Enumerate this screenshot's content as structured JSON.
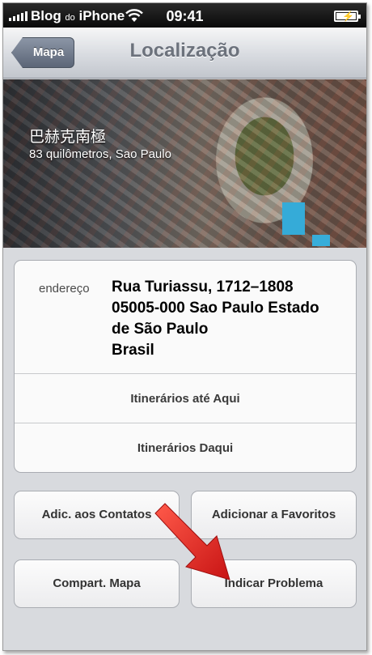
{
  "status_bar": {
    "carrier": "Blog",
    "carrier_small": "do",
    "carrier_tail": "iPhone",
    "time": "09:41"
  },
  "nav": {
    "back_label": "Mapa",
    "title": "Localização"
  },
  "place": {
    "name": "巴赫克南極",
    "subtitle": "83 quilômetros, Sao Paulo"
  },
  "address": {
    "label": "endereço",
    "lines": [
      "Rua Turiassu, 1712–1808",
      "05005-000 Sao Paulo Estado",
      "de São Paulo",
      "Brasil"
    ]
  },
  "actions": {
    "directions_to": "Itinerários até Aqui",
    "directions_from": "Itinerários Daqui"
  },
  "buttons": {
    "add_contacts": "Adic. aos Contatos",
    "add_favorites": "Adicionar a Favoritos",
    "share_map": "Compart. Mapa",
    "report_problem": "Indicar Problema"
  },
  "colors": {
    "arrow": "#e8282a"
  }
}
